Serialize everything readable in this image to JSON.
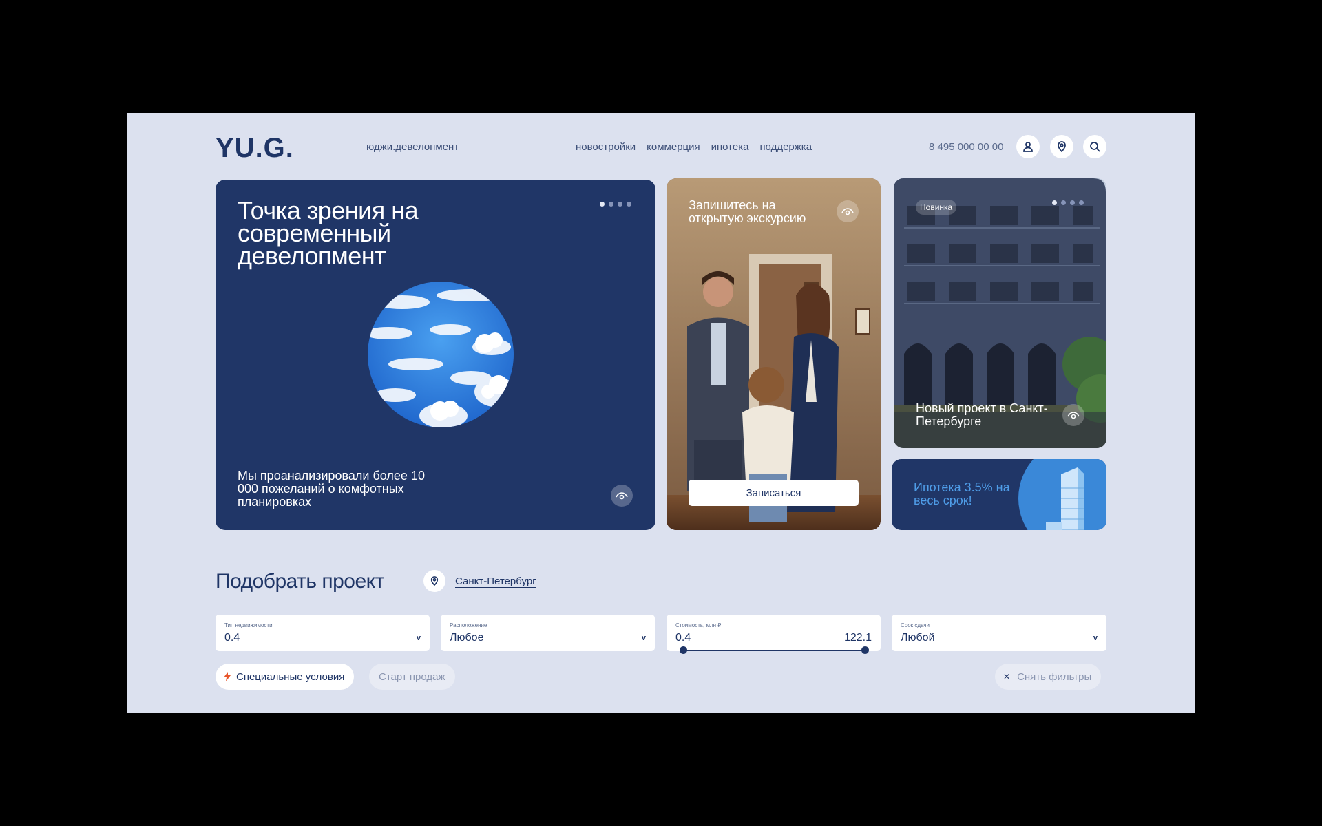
{
  "header": {
    "logo": "YU.G.",
    "tagline": "юджи.девелопмент",
    "nav": [
      "новостройки",
      "коммерция",
      "ипотека",
      "поддержка"
    ],
    "phone": "8 495 000 00 00",
    "icons": [
      "user-icon",
      "map-pin-icon",
      "search-icon"
    ]
  },
  "hero": {
    "title": "Точка зрения на современный девелопмент",
    "subtitle": "Мы проанализировали более 10 000 пожеланий о комфотных планировках"
  },
  "tour": {
    "title": "Запишитесь на открытую экскурсию",
    "button": "Записаться"
  },
  "project": {
    "badge": "Новинка",
    "title": "Новый проект в Санкт-Петербурге"
  },
  "mortgage": {
    "title": "Ипотека 3.5% на весь срок!"
  },
  "selector": {
    "title": "Подобрать проект",
    "city": "Санкт-Петербург",
    "filters": [
      {
        "label": "Тип недвижимости",
        "value": "0.4"
      },
      {
        "label": "Расположение",
        "value": "Любое"
      },
      {
        "label": "Стоимость, млн ₽",
        "min": "0.4",
        "max": "122.1"
      },
      {
        "label": "Срок сдачи",
        "value": "Любой"
      }
    ],
    "chips": {
      "special": "Специальные условия",
      "start": "Старт продаж",
      "reset": "Снять фильтры"
    }
  },
  "colors": {
    "background": "#dce1ef",
    "primary": "#203667",
    "accent": "#4f9de8",
    "lightning": "#e8562c"
  }
}
